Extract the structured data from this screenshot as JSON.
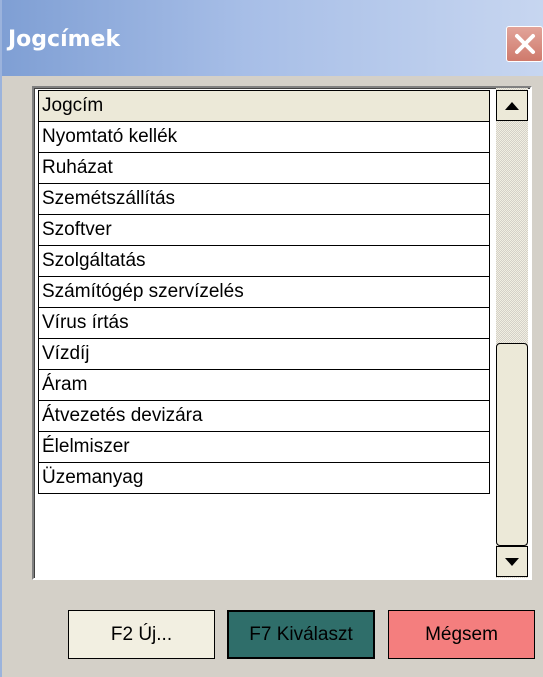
{
  "window": {
    "title": "Jogcímek"
  },
  "list": {
    "header": "Jogcím",
    "items": [
      "Nyomtató kellék",
      "Ruházat",
      "Szemétszállítás",
      "Szoftver",
      "Szolgáltatás",
      "Számítógép szervízelés",
      "Vírus írtás",
      "Vízdíj",
      "Áram",
      "Átvezetés devizára",
      "Élelmiszer",
      "Üzemanyag"
    ]
  },
  "buttons": {
    "new": "F2 Új...",
    "select": "F7 Kiválaszt",
    "cancel": "Mégsem"
  },
  "colors": {
    "select_button": "#2f6e6a",
    "cancel_button": "#f47e7e",
    "new_button": "#f2efe1",
    "title_gradient_start": "#7f9fd4"
  },
  "icons": {
    "close": "close-icon",
    "scroll_up": "arrow-up-icon",
    "scroll_down": "arrow-down-icon"
  }
}
